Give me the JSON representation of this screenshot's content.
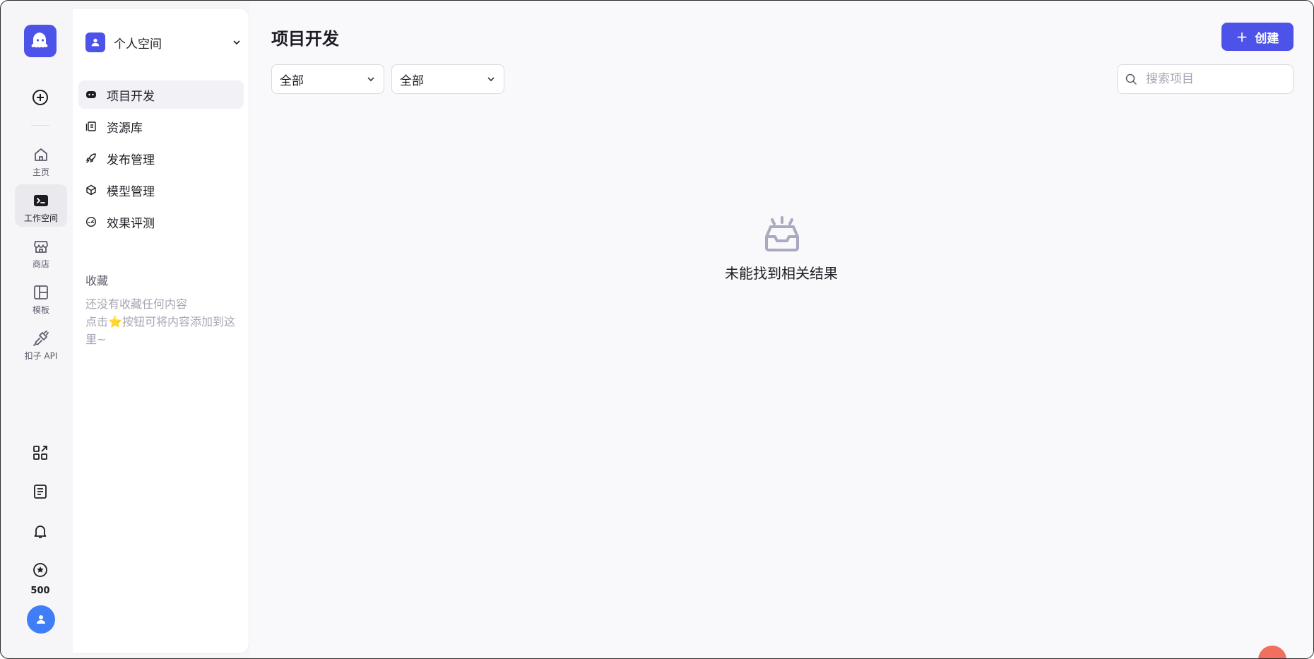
{
  "rail": {
    "items": [
      {
        "label": "主页",
        "icon": "home-icon"
      },
      {
        "label": "工作空间",
        "icon": "terminal-icon"
      },
      {
        "label": "商店",
        "icon": "store-icon"
      },
      {
        "label": "模板",
        "icon": "template-icon"
      },
      {
        "label": "扣子 API",
        "icon": "api-plug-icon"
      }
    ],
    "credits": "500"
  },
  "sidebar": {
    "space_name": "个人空间",
    "nav": [
      {
        "label": "项目开发",
        "icon": "bot-icon"
      },
      {
        "label": "资源库",
        "icon": "library-icon"
      },
      {
        "label": "发布管理",
        "icon": "rocket-icon"
      },
      {
        "label": "模型管理",
        "icon": "cube-icon"
      },
      {
        "label": "效果评测",
        "icon": "gauge-icon"
      }
    ],
    "favorites_title": "收藏",
    "favorites_empty_line1": "还没有收藏任何内容",
    "favorites_empty_line2a": "点击",
    "favorites_empty_star": "⭐",
    "favorites_empty_line2b": "按钮可将内容添加到这里~"
  },
  "main": {
    "title": "项目开发",
    "create_label": "创建",
    "create_plus": "+",
    "filter1": "全部",
    "filter2": "全部",
    "search_placeholder": "搜索项目",
    "empty_text": "未能找到相关结果"
  },
  "colors": {
    "accent": "#4d53e8",
    "avatar": "#3f7ef7"
  }
}
